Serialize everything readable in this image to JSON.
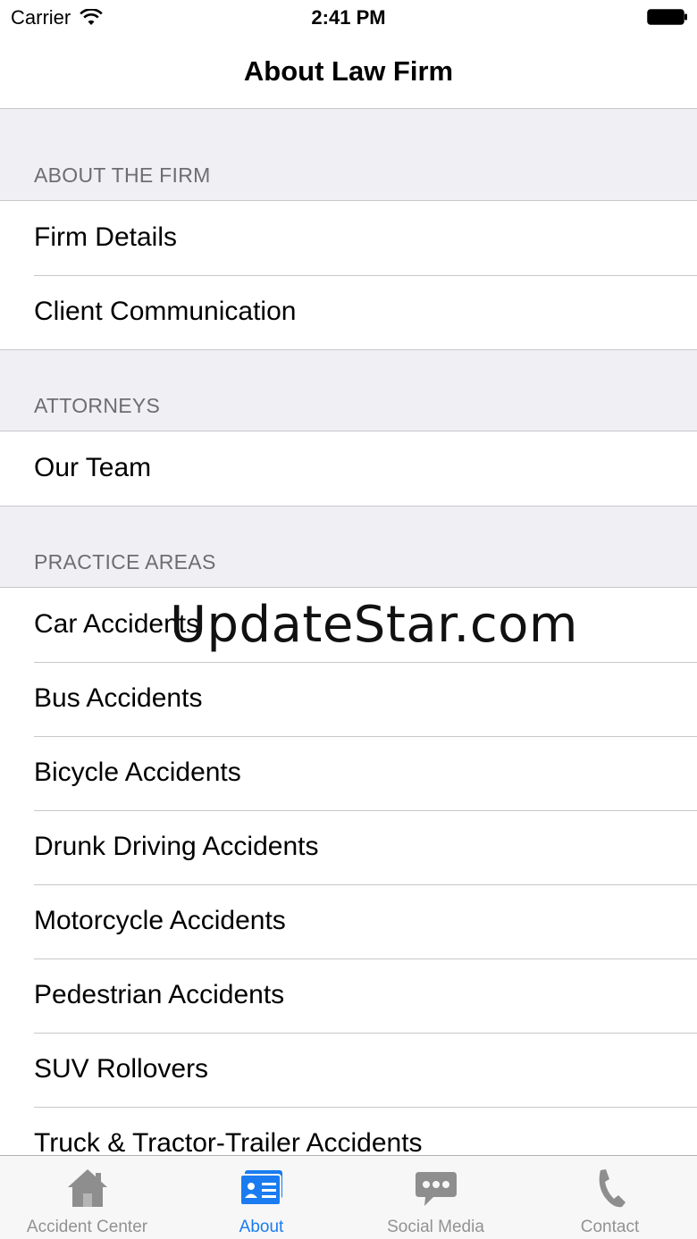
{
  "status_bar": {
    "carrier": "Carrier",
    "time": "2:41 PM"
  },
  "nav": {
    "title": "About Law Firm"
  },
  "sections": [
    {
      "header": "ABOUT THE FIRM",
      "items": [
        "Firm Details",
        "Client Communication"
      ]
    },
    {
      "header": "ATTORNEYS",
      "items": [
        "Our Team"
      ]
    },
    {
      "header": "PRACTICE AREAS",
      "items": [
        "Car Accidents",
        "Bus Accidents",
        "Bicycle Accidents",
        "Drunk Driving Accidents",
        "Motorcycle Accidents",
        "Pedestrian Accidents",
        "SUV Rollovers",
        "Truck & Tractor-Trailer Accidents"
      ]
    }
  ],
  "watermark": "UpdateStar.com",
  "tabs": [
    {
      "label": "Accident Center",
      "icon": "house-icon",
      "active": false
    },
    {
      "label": "About",
      "icon": "contact-card-icon",
      "active": true
    },
    {
      "label": "Social Media",
      "icon": "chat-bubble-icon",
      "active": false
    },
    {
      "label": "Contact",
      "icon": "phone-icon",
      "active": false
    }
  ],
  "colors": {
    "accent": "#1a7cf0",
    "inactive": "#929292",
    "background": "#efeff4"
  }
}
